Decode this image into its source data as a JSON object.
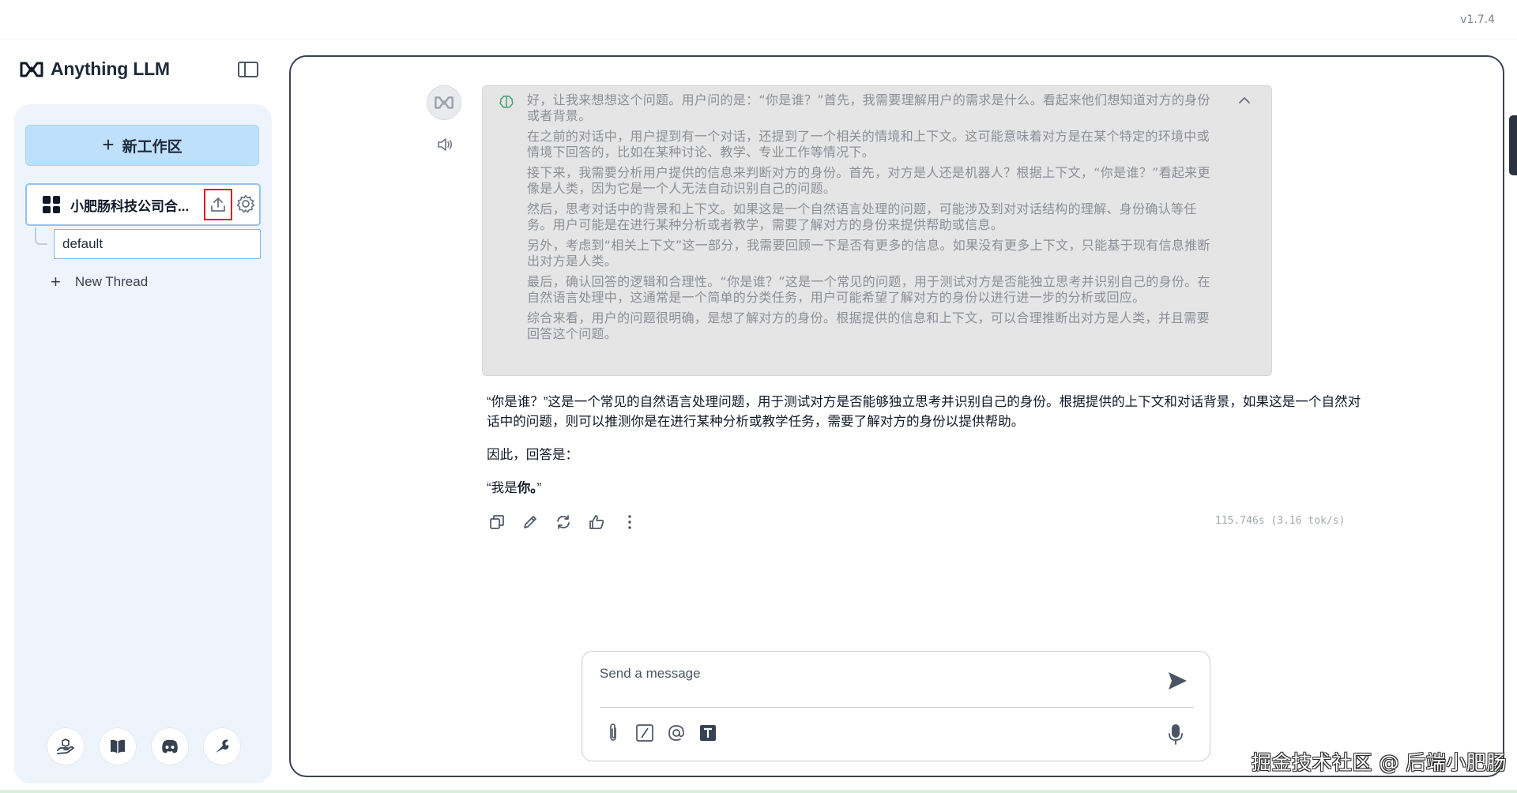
{
  "app": {
    "version": "v1.7.4",
    "brand_name": "Anything LLM"
  },
  "sidebar": {
    "new_workspace_label": "新工作区",
    "workspace": {
      "name": "小肥肠科技公司合..."
    },
    "threads": [
      {
        "label": "default"
      }
    ],
    "new_thread_label": "New Thread",
    "footer_icons": [
      "community-hub-icon",
      "docs-book-icon",
      "discord-icon",
      "wrench-settings-icon"
    ]
  },
  "chat": {
    "thinking": [
      "好，让我来想想这个问题。用户问的是：“你是谁？”首先，我需要理解用户的需求是什么。看起来他们想知道对方的身份或者背景。",
      "在之前的对话中，用户提到有一个对话，还提到了一个相关的情境和上下文。这可能意味着对方是在某个特定的环境中或情境下回答的，比如在某种讨论、教学、专业工作等情况下。",
      "接下来，我需要分析用户提供的信息来判断对方的身份。首先，对方是人还是机器人？根据上下文，“你是谁？”看起来更像是人类，因为它是一个人无法自动识别自己的问题。",
      "然后，思考对话中的背景和上下文。如果这是一个自然语言处理的问题，可能涉及到对对话结构的理解、身份确认等任务。用户可能是在进行某种分析或者教学，需要了解对方的身份来提供帮助或信息。",
      "另外，考虑到“相关上下文”这一部分，我需要回顾一下是否有更多的信息。如果没有更多上下文，只能基于现有信息推断出对方是人类。",
      "最后，确认回答的逻辑和合理性。“你是谁？”这是一个常见的问题，用于测试对方是否能独立思考并识别自己的身份。在自然语言处理中，这通常是一个简单的分类任务，用户可能希望了解对方的身份以进行进一步的分析或回应。",
      "综合来看，用户的问题很明确，是想了解对方的身份。根据提供的信息和上下文，可以合理推断出对方是人类，并且需要回答这个问题。"
    ],
    "answer": {
      "p1": "“你是谁？”这是一个常见的自然语言处理问题，用于测试对方是否能够独立思考并识别自己的身份。根据提供的上下文和对话背景，如果这是一个自然对话中的问题，则可以推测你是在进行某种分析或教学任务，需要了解对方的身份以提供帮助。",
      "p2": "因此，回答是：",
      "p3_prefix": "“我是",
      "p3_bold": "你。",
      "p3_suffix": "”"
    },
    "metrics": "115.746s (3.16 tok/s)"
  },
  "composer": {
    "placeholder": "Send a message",
    "value": ""
  },
  "watermark": "掘金技术社区 @ 后端小肥肠",
  "colors": {
    "accent_button": "#bfe0fb",
    "sidebar_bg": "#eef4fb",
    "highlight_box": "#e11d1d",
    "thinking_bg": "#e5e5e5"
  }
}
